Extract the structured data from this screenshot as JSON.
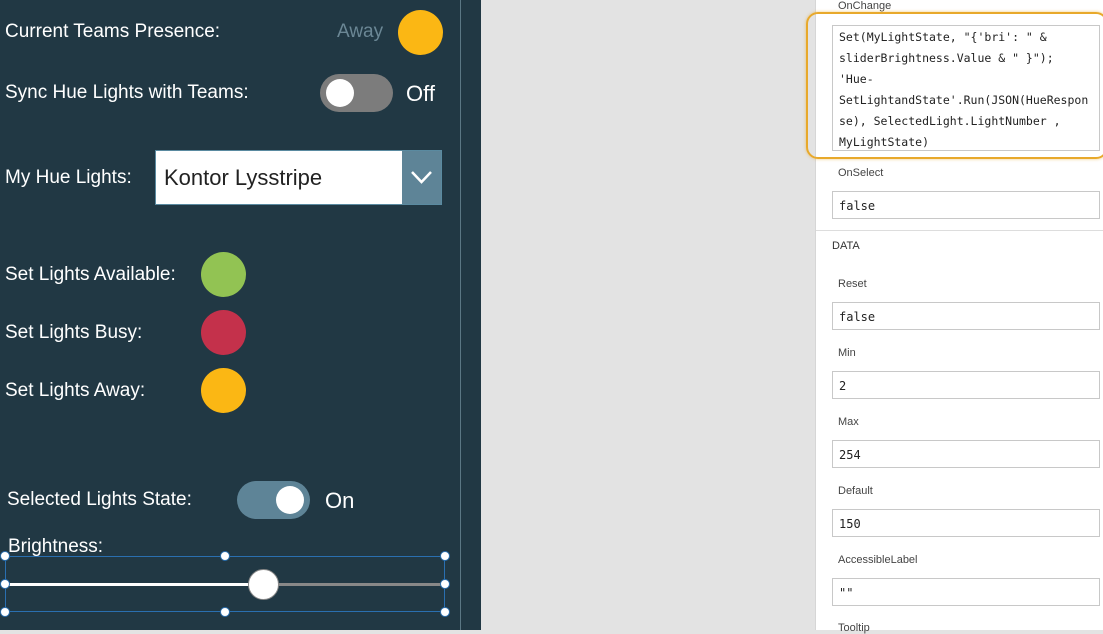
{
  "app": {
    "presence_label": "Current Teams Presence:",
    "presence_value": "Away",
    "presence_color": "#fbb714",
    "sync_label": "Sync Hue Lights with Teams:",
    "sync_state": "Off",
    "lights_label": "My Hue Lights:",
    "lights_selected": "Kontor Lysstripe",
    "available_label": "Set Lights Available:",
    "available_color": "#92c353",
    "busy_label": "Set Lights Busy:",
    "busy_color": "#c4314b",
    "away_label": "Set Lights Away:",
    "away_color": "#fbb714",
    "state_label": "Selected Lights State:",
    "state_value": "On",
    "brightness_label": "Brightness:"
  },
  "panel": {
    "onchange_label": "OnChange",
    "onchange_formula": "Set(MyLightState, \"{'bri': \" &\nsliderBrightness.Value & \" }\");\n'Hue-\nSetLightandState'.Run(JSON(HueRespon\nse), SelectedLight.LightNumber ,\nMyLightState)",
    "onselect_label": "OnSelect",
    "onselect_value": "false",
    "data_header": "DATA",
    "reset_label": "Reset",
    "reset_value": "false",
    "min_label": "Min",
    "min_value": "2",
    "max_label": "Max",
    "max_value": "254",
    "default_label": "Default",
    "default_value": "150",
    "accessible_label": "AccessibleLabel",
    "accessible_value": "\"\"",
    "tooltip_label": "Tooltip"
  }
}
